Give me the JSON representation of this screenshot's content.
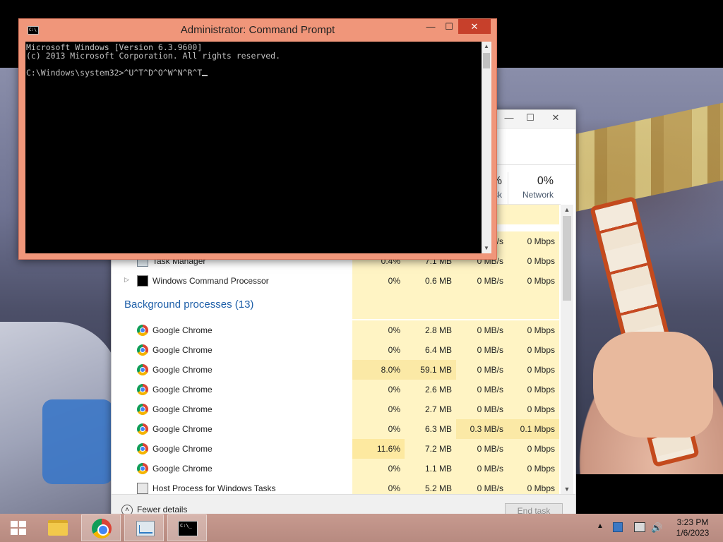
{
  "cmd": {
    "title": "Administrator:  Command Prompt",
    "icon": "cmd-icon",
    "lines": [
      "Microsoft Windows [Version 6.3.9600]",
      "(c) 2013 Microsoft Corporation. All rights reserved.",
      "",
      "C:\\Windows\\system32>^U^T^D^O^W^N^R^T"
    ],
    "buttons": {
      "minimize": "—",
      "maximize": "☐",
      "close": "✕"
    }
  },
  "taskmgr": {
    "buttons": {
      "minimize": "—",
      "maximize": "☐",
      "close": "✕"
    },
    "columns": {
      "disk": {
        "pct": "%",
        "name": "sk"
      },
      "network": {
        "pct": "0%",
        "name": "Network"
      }
    },
    "apps_partial": [
      {
        "name": "Task Manager",
        "cpu": "0.4%",
        "memory": "7.1 MB",
        "disk": "0 MB/s",
        "network": "0 Mbps",
        "icon": "task-manager-icon"
      },
      {
        "name": "Windows Command Processor",
        "cpu": "0%",
        "memory": "0.6 MB",
        "disk": "0 MB/s",
        "network": "0 Mbps",
        "icon": "command-prompt-icon"
      }
    ],
    "partial_row_above": {
      "disk": "/s",
      "network": "0 Mbps"
    },
    "background_group": "Background processes (13)",
    "background": [
      {
        "name": "Google Chrome",
        "cpu": "0%",
        "memory": "2.8 MB",
        "disk": "0 MB/s",
        "network": "0 Mbps"
      },
      {
        "name": "Google Chrome",
        "cpu": "0%",
        "memory": "6.4 MB",
        "disk": "0 MB/s",
        "network": "0 Mbps"
      },
      {
        "name": "Google Chrome",
        "cpu": "8.0%",
        "memory": "59.1 MB",
        "disk": "0 MB/s",
        "network": "0 Mbps"
      },
      {
        "name": "Google Chrome",
        "cpu": "0%",
        "memory": "2.6 MB",
        "disk": "0 MB/s",
        "network": "0 Mbps"
      },
      {
        "name": "Google Chrome",
        "cpu": "0%",
        "memory": "2.7 MB",
        "disk": "0 MB/s",
        "network": "0 Mbps"
      },
      {
        "name": "Google Chrome",
        "cpu": "0%",
        "memory": "6.3 MB",
        "disk": "0.3 MB/s",
        "network": "0.1 Mbps"
      },
      {
        "name": "Google Chrome",
        "cpu": "11.6%",
        "memory": "7.2 MB",
        "disk": "0 MB/s",
        "network": "0 Mbps"
      },
      {
        "name": "Google Chrome",
        "cpu": "0%",
        "memory": "1.1 MB",
        "disk": "0 MB/s",
        "network": "0 Mbps"
      },
      {
        "name": "Host Process for Windows Tasks",
        "cpu": "0%",
        "memory": "5.2 MB",
        "disk": "0 MB/s",
        "network": "0 Mbps"
      }
    ],
    "footer": {
      "fewer_details": "Fewer details",
      "end_task": "End task"
    }
  },
  "taskbar": {
    "items": [
      {
        "name": "start",
        "icon": "windows-logo-icon"
      },
      {
        "name": "file-explorer",
        "icon": "folder-icon"
      },
      {
        "name": "chrome",
        "icon": "chrome-icon"
      },
      {
        "name": "task-manager",
        "icon": "task-manager-icon"
      },
      {
        "name": "command-prompt",
        "icon": "cmd-icon"
      }
    ],
    "clock": {
      "time": "3:23 PM",
      "date": "1/6/2023"
    }
  },
  "colors": {
    "cmd_frame": "#f0967a",
    "cmd_close": "#c7402b",
    "group_title": "#1e5fa8",
    "heat_light": "#fff4c4",
    "heat_strong": "#fde9a0",
    "taskbar": "#c79a8f"
  }
}
